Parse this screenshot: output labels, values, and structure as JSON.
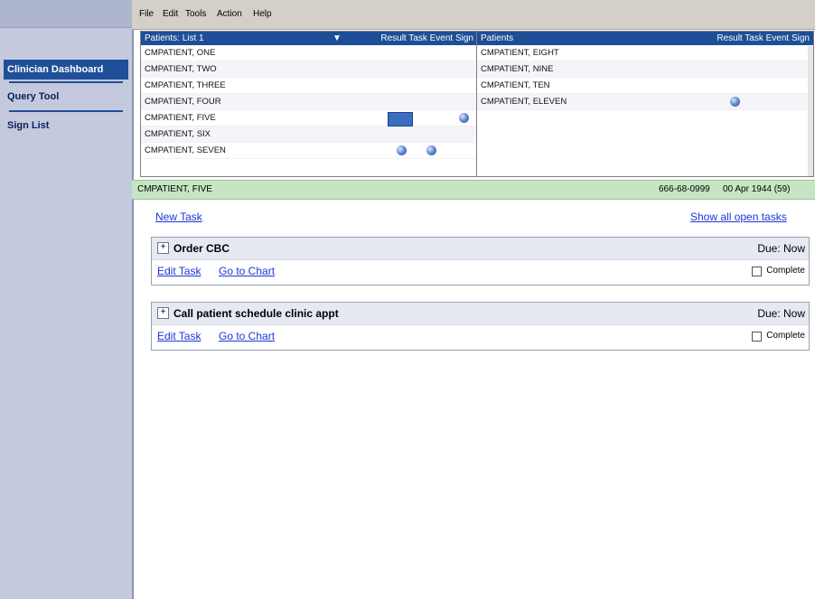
{
  "menu": [
    "File",
    "Edit",
    "Tools",
    "Action",
    "Help"
  ],
  "sidebar": {
    "items": [
      {
        "label": "Clinician Dashboard",
        "active": true
      },
      {
        "label": "Query Tool",
        "active": false
      },
      {
        "label": "Sign List",
        "active": false
      }
    ]
  },
  "list_left": {
    "title": "Patients: List 1",
    "columns": "Result  Task  Event  Sign",
    "rows": [
      "CMPATIENT, ONE",
      "CMPATIENT, TWO",
      "CMPATIENT, THREE",
      "CMPATIENT, FOUR",
      "CMPATIENT, FIVE",
      "CMPATIENT, SIX",
      "CMPATIENT, SEVEN"
    ]
  },
  "list_right": {
    "title": "Patients",
    "columns": "Result  Task  Event  Sign",
    "rows": [
      "CMPATIENT, EIGHT",
      "CMPATIENT, NINE",
      "CMPATIENT, TEN",
      "CMPATIENT, ELEVEN"
    ]
  },
  "selected_patient": {
    "name": "CMPATIENT, FIVE",
    "ssn": "666-68-0999",
    "dob": "00 Apr 1944  (59)"
  },
  "actions": {
    "new_task": "New Task",
    "show_all": "Show all open tasks"
  },
  "tasks": [
    {
      "name": "Order CBC",
      "due": "Due: Now",
      "edit": "Edit Task",
      "chart": "Go to Chart",
      "complete": "Complete"
    },
    {
      "name": "Call patient schedule clinic appt",
      "due": "Due: Now",
      "edit": "Edit Task",
      "chart": "Go to Chart",
      "complete": "Complete"
    }
  ],
  "colors": {
    "header_blue": "#1d4e97",
    "patient_bar_green": "#c6e5c2",
    "link_blue": "#1a36d6"
  }
}
